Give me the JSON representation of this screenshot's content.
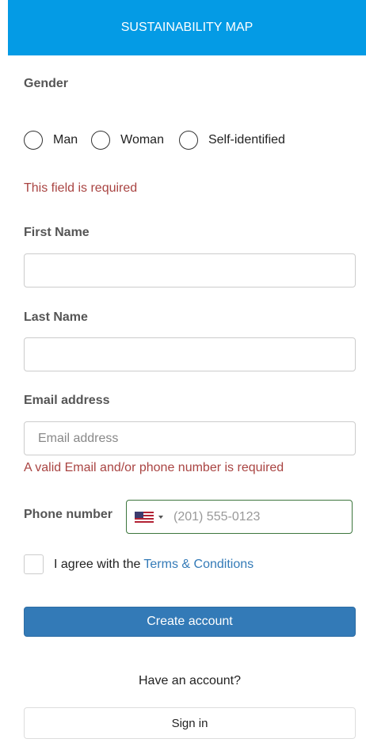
{
  "header": {
    "title": "SUSTAINABILITY MAP"
  },
  "form": {
    "gender": {
      "label": "Gender",
      "options": [
        "Man",
        "Woman",
        "Self-identified"
      ],
      "error": "This field is required"
    },
    "first_name": {
      "label": "First Name",
      "value": ""
    },
    "last_name": {
      "label": "Last Name",
      "value": ""
    },
    "email": {
      "label": "Email address",
      "placeholder": "Email address",
      "error": "A valid Email and/or phone number is required"
    },
    "phone": {
      "label": "Phone number",
      "country_flag": "us-flag-icon",
      "placeholder": "(201) 555-0123"
    },
    "agree": {
      "text": "I agree with the",
      "link": "Terms & Conditions"
    },
    "create_button": "Create account"
  },
  "footer": {
    "have_account": "Have an account?",
    "signin_button": "Sign in"
  },
  "colors": {
    "header_bg": "#049be5",
    "primary": "#337ab7",
    "error": "#a94442",
    "valid_border": "#3c763d"
  }
}
